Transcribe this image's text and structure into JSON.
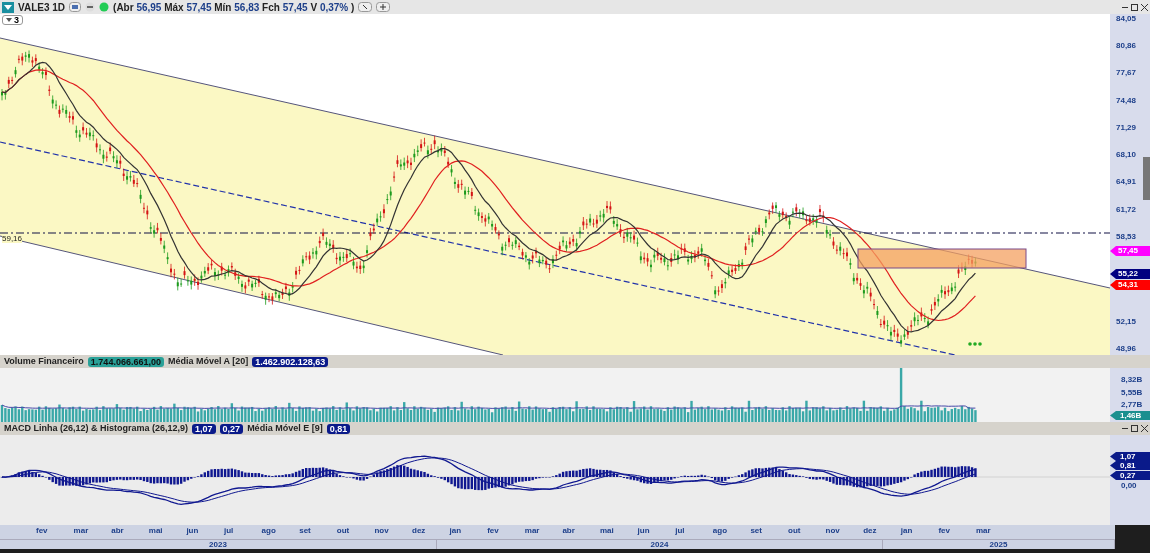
{
  "header": {
    "symbol": "VALE3 1D",
    "quote": [
      {
        "label": "(Abr",
        "value": "56,95"
      },
      {
        "label": "Máx",
        "value": "57,45"
      },
      {
        "label": "Mín",
        "value": "56,83"
      },
      {
        "label": "Fch",
        "value": "57,45"
      },
      {
        "label": "V",
        "value": "0,37%"
      }
    ],
    "quote_end": ")"
  },
  "layout_button": "3",
  "price_panel": {
    "level_label": "59,16",
    "axis_labels": [
      "84,05",
      "80,86",
      "77,67",
      "74,48",
      "71,29",
      "68,10",
      "64,91",
      "61,72",
      "58,53",
      "52,15",
      "48,96"
    ],
    "badges": [
      {
        "text": "57,45",
        "color": "#ff00ff"
      },
      {
        "text": "55,22",
        "color": "#000080"
      },
      {
        "text": "54,31",
        "color": "#ff0000"
      }
    ]
  },
  "volume_panel": {
    "title": "Volume Financeiro",
    "value": "1.744.066.661,00",
    "ma_label": "Média Móvel A [20]",
    "ma_value": "1.462.902.128,63",
    "axis_labels": [
      "8,32B",
      "5,55B",
      "2,77B"
    ],
    "badge": "1,46B"
  },
  "macd_panel": {
    "title": "MACD Linha (26,12) & Histograma (26,12,9)",
    "values": [
      "1,07",
      "0,27"
    ],
    "ma_label": "Média Móvel E [9]",
    "ma_value": "0,81",
    "axis_label": "0,00",
    "badges": [
      "1,07",
      "0,81",
      "0,27"
    ]
  },
  "months": [
    "fev",
    "mar",
    "abr",
    "mai",
    "jun",
    "jul",
    "ago",
    "set",
    "out",
    "nov",
    "dez",
    "jan",
    "fev",
    "mar",
    "abr",
    "mai",
    "jun",
    "jul",
    "ago",
    "set",
    "out",
    "nov",
    "dez",
    "jan",
    "fev",
    "mar"
  ],
  "years": [
    "2023",
    "2024",
    "2025"
  ]
}
